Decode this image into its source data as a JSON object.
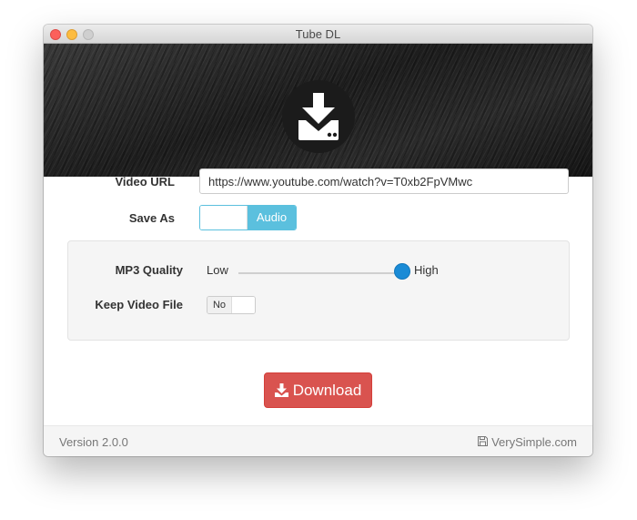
{
  "window": {
    "title": "Tube DL"
  },
  "hero": {
    "icon": "download-drive-icon"
  },
  "form": {
    "video_url_label": "Video URL",
    "video_url_value": "https://www.youtube.com/watch?v=T0xb2FpVMwc",
    "save_as_label": "Save As",
    "save_as_toggle_value": "Audio"
  },
  "options": {
    "mp3_quality_label": "MP3 Quality",
    "quality_low_label": "Low",
    "quality_high_label": "High",
    "quality_level": 1.0,
    "keep_video_label": "Keep Video File",
    "keep_video_value": "No"
  },
  "actions": {
    "download_label": "Download",
    "download_icon": "download-icon"
  },
  "footer": {
    "version": "Version 2.0.0",
    "brand": "VerySimple.com",
    "brand_icon": "floppy-disk-icon"
  },
  "colors": {
    "accent": "#5bc0de",
    "slider_thumb": "#1a8bd6",
    "danger": "#d9534f"
  }
}
